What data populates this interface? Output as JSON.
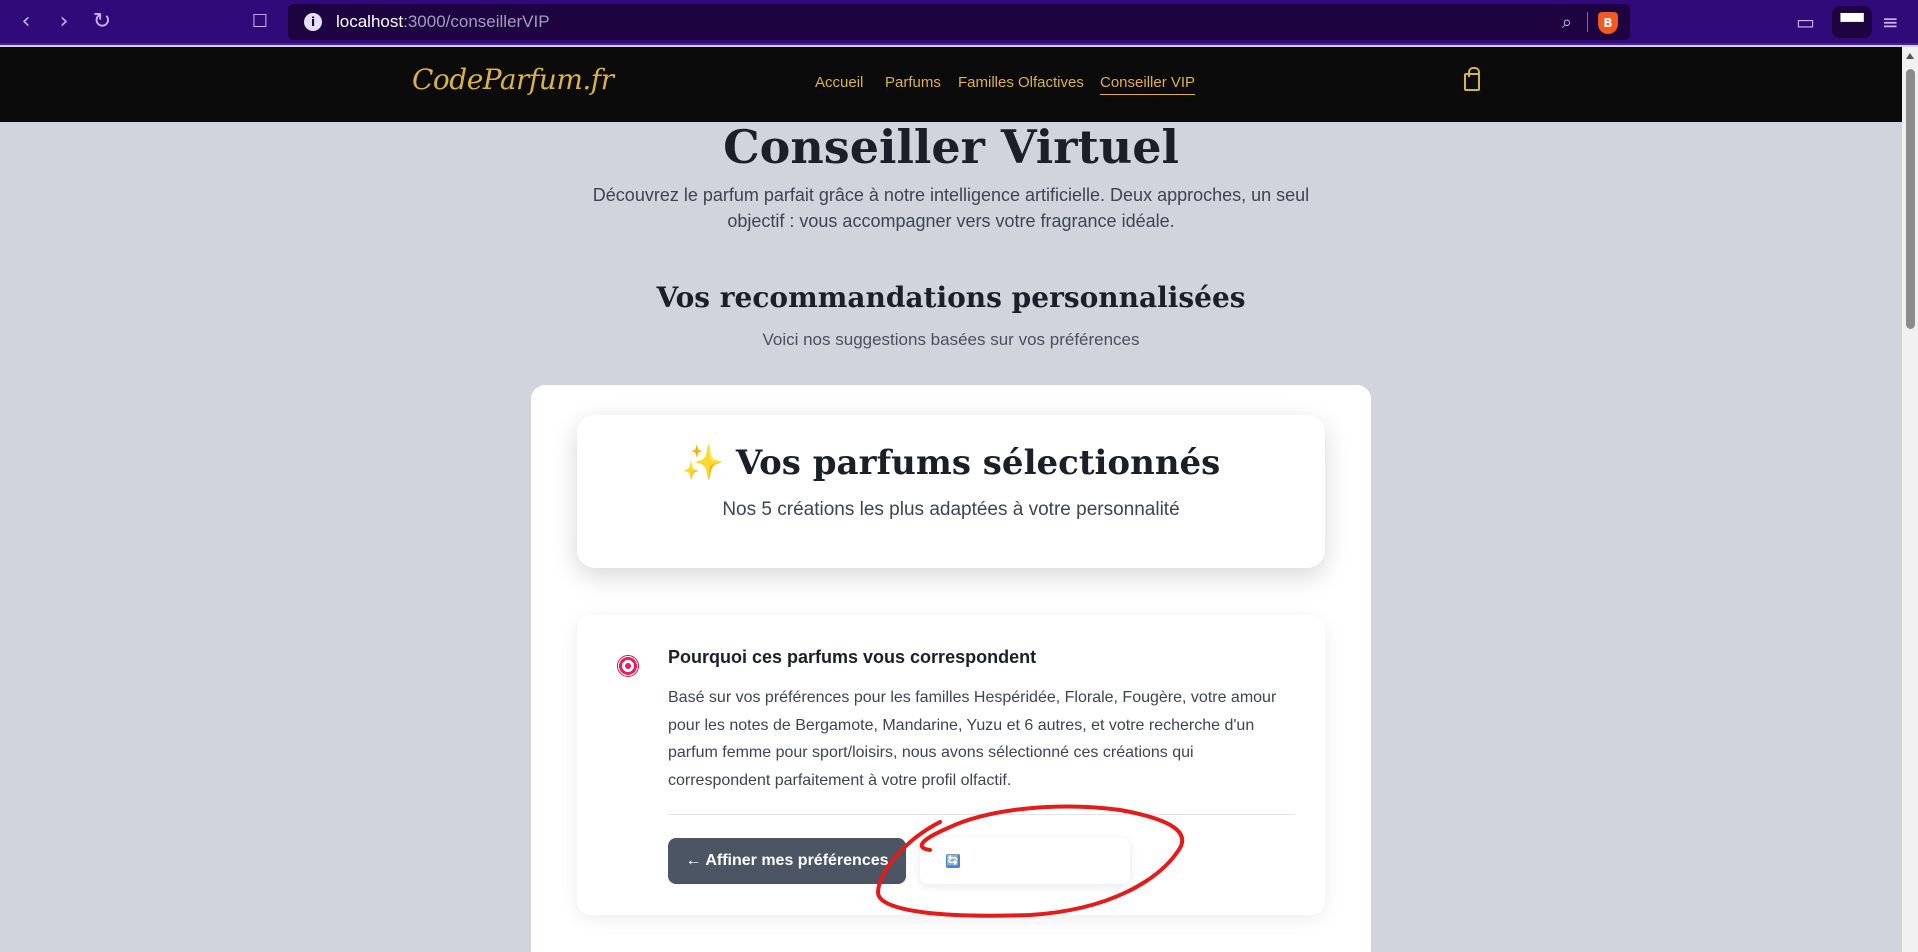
{
  "browser": {
    "url_host": "localhost",
    "url_path": ":3000/conseillerVIP",
    "info_icon": "info-icon",
    "brave_icon": "brave-lion-icon"
  },
  "header": {
    "logo": "CodeParfum.fr",
    "nav": [
      "Accueil",
      "Parfums",
      "Familles Olfactives",
      "Conseiller VIP"
    ],
    "active_nav": "Conseiller VIP",
    "gold": "#d9b24a"
  },
  "page": {
    "title": "Conseiller Virtuel",
    "description": "Découvrez le parfum parfait grâce à notre intelligence artificielle. Deux approches, un seul objectif : vous accompagner vers votre fragrance idéale.",
    "section_title": "Vos recommandations personnalisées",
    "section_subtitle": "Voici nos suggestions basées sur vos préférences"
  },
  "selection": {
    "emoji": "✨",
    "title": "Vos parfums sélectionnés",
    "subtitle": "Nos 5 créations les plus adaptées à votre personnalité"
  },
  "why": {
    "title": "Pourquoi ces parfums vous correspondent",
    "text": "Basé sur vos préférences pour les familles Hespéridée, Florale, Fougère, votre amour pour les notes de Bergamote, Mandarine, Yuzu et 6 autres, et votre recherche d'un parfum femme pour sport/loisirs, nous avons sélectionné ces créations qui correspondent parfaitement à votre profil olfactif."
  },
  "actions": {
    "refine_label": "← Affiner mes préférences",
    "refresh_icon": "🔄"
  }
}
